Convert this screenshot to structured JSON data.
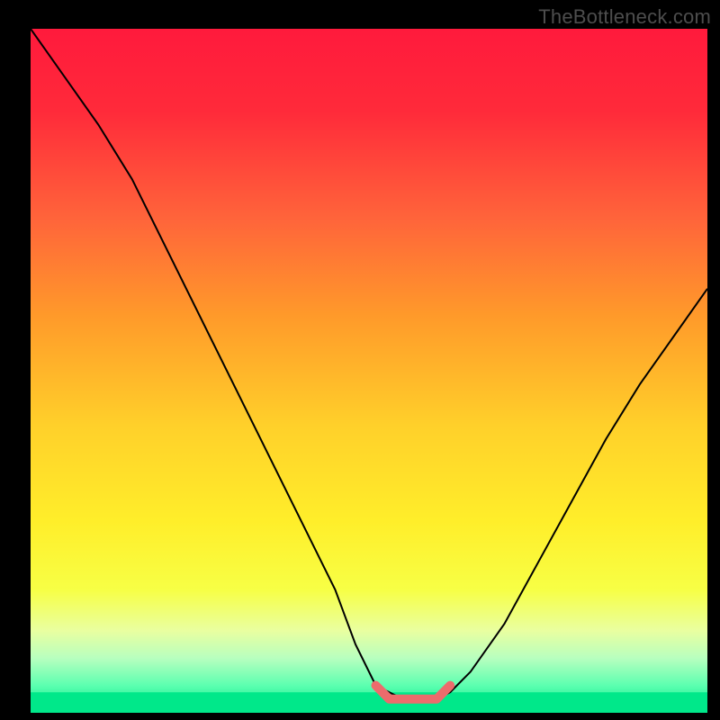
{
  "watermark": "TheBottleneck.com",
  "chart_data": {
    "type": "line",
    "title": "",
    "xlabel": "",
    "ylabel": "",
    "xlim": [
      0,
      100
    ],
    "ylim": [
      0,
      100
    ],
    "grid": false,
    "legend": false,
    "gradient_stops": [
      {
        "offset": 0.0,
        "color": "#ff1a3c"
      },
      {
        "offset": 0.12,
        "color": "#ff2a3a"
      },
      {
        "offset": 0.28,
        "color": "#ff653a"
      },
      {
        "offset": 0.42,
        "color": "#ff9a2a"
      },
      {
        "offset": 0.58,
        "color": "#ffd02a"
      },
      {
        "offset": 0.72,
        "color": "#ffee2a"
      },
      {
        "offset": 0.82,
        "color": "#f7ff45"
      },
      {
        "offset": 0.88,
        "color": "#e9ffa0"
      },
      {
        "offset": 0.92,
        "color": "#b8ffbf"
      },
      {
        "offset": 0.96,
        "color": "#5cffb0"
      },
      {
        "offset": 1.0,
        "color": "#00e88a"
      }
    ],
    "series": [
      {
        "name": "bottleneck-curve",
        "stroke": "#000000",
        "stroke_width": 2,
        "x": [
          0,
          5,
          10,
          15,
          20,
          25,
          30,
          35,
          40,
          45,
          48,
          51,
          55,
          60,
          62,
          65,
          70,
          75,
          80,
          85,
          90,
          95,
          100
        ],
        "y": [
          100,
          93,
          86,
          78,
          68,
          58,
          48,
          38,
          28,
          18,
          10,
          4,
          2,
          2,
          3,
          6,
          13,
          22,
          31,
          40,
          48,
          55,
          62
        ]
      },
      {
        "name": "flat-segment",
        "stroke": "#ec6b6c",
        "stroke_width": 10,
        "linecap": "round",
        "x": [
          51,
          53,
          57,
          60,
          62
        ],
        "y": [
          4,
          2,
          2,
          2,
          4
        ]
      }
    ],
    "green_band": {
      "y_from": 0,
      "y_to": 3
    }
  }
}
